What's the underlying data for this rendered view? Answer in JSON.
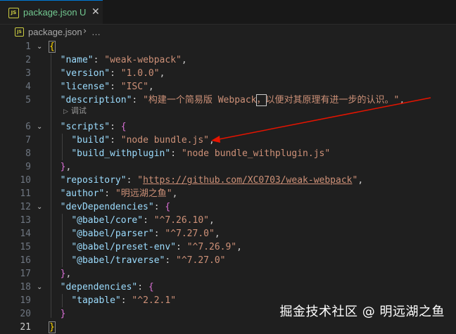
{
  "tab": {
    "filename": "package.json",
    "status": "U",
    "icon": "js-icon"
  },
  "breadcrumb": {
    "file": "package.json",
    "separator": "›",
    "more": "…"
  },
  "codelens": "调试",
  "watermark": "掘金技术社区 @ 明远湖之鱼",
  "lines": [
    {
      "n": "1"
    },
    {
      "n": "2"
    },
    {
      "n": "3"
    },
    {
      "n": "4"
    },
    {
      "n": "5"
    },
    {
      "n": "6"
    },
    {
      "n": "7"
    },
    {
      "n": "8"
    },
    {
      "n": "9"
    },
    {
      "n": "10"
    },
    {
      "n": "11"
    },
    {
      "n": "12"
    },
    {
      "n": "13"
    },
    {
      "n": "14"
    },
    {
      "n": "15"
    },
    {
      "n": "16"
    },
    {
      "n": "17"
    },
    {
      "n": "18"
    },
    {
      "n": "19"
    },
    {
      "n": "20"
    },
    {
      "n": "21"
    }
  ],
  "code": {
    "l1": "{",
    "l2_k": "\"name\"",
    "l2_v": "\"weak-webpack\"",
    "l3_k": "\"version\"",
    "l3_v": "\"1.0.0\"",
    "l4_k": "\"license\"",
    "l4_v": "\"ISC\"",
    "l5_k": "\"description\"",
    "l5_v1": "\"构建一个简易版 Webpack",
    "l5_v2": "，",
    "l5_v3": "以便对其原理有进一步的认识。\"",
    "l6_k": "\"scripts\"",
    "l6_b": "{",
    "l7_k": "\"build\"",
    "l7_v": "\"node bundle.js\"",
    "l8_k": "\"build_withplugin\"",
    "l8_v": "\"node bundle_withplugin.js\"",
    "l9_b": "}",
    "l10_k": "\"repository\"",
    "l10_q1": "\"",
    "l10_v": "https://github.com/XC0703/weak-webpack",
    "l10_q2": "\"",
    "l11_k": "\"author\"",
    "l11_v": "\"明远湖之鱼\"",
    "l12_k": "\"devDependencies\"",
    "l12_b": "{",
    "l13_k": "\"@babel/core\"",
    "l13_v": "\"^7.26.10\"",
    "l14_k": "\"@babel/parser\"",
    "l14_v": "\"^7.27.0\"",
    "l15_k": "\"@babel/preset-env\"",
    "l15_v": "\"^7.26.9\"",
    "l16_k": "\"@babel/traverse\"",
    "l16_v": "\"^7.27.0\"",
    "l17_b": "}",
    "l18_k": "\"dependencies\"",
    "l18_b": "{",
    "l19_k": "\"tapable\"",
    "l19_v": "\"^2.2.1\"",
    "l20_b": "}",
    "l21": "}"
  },
  "colors": {
    "key": "#9cdcfe",
    "string": "#ce9178",
    "bracket1": "#ffd700",
    "bracket2": "#da70d6",
    "annotation": "#e51400",
    "modified": "#73c991"
  }
}
